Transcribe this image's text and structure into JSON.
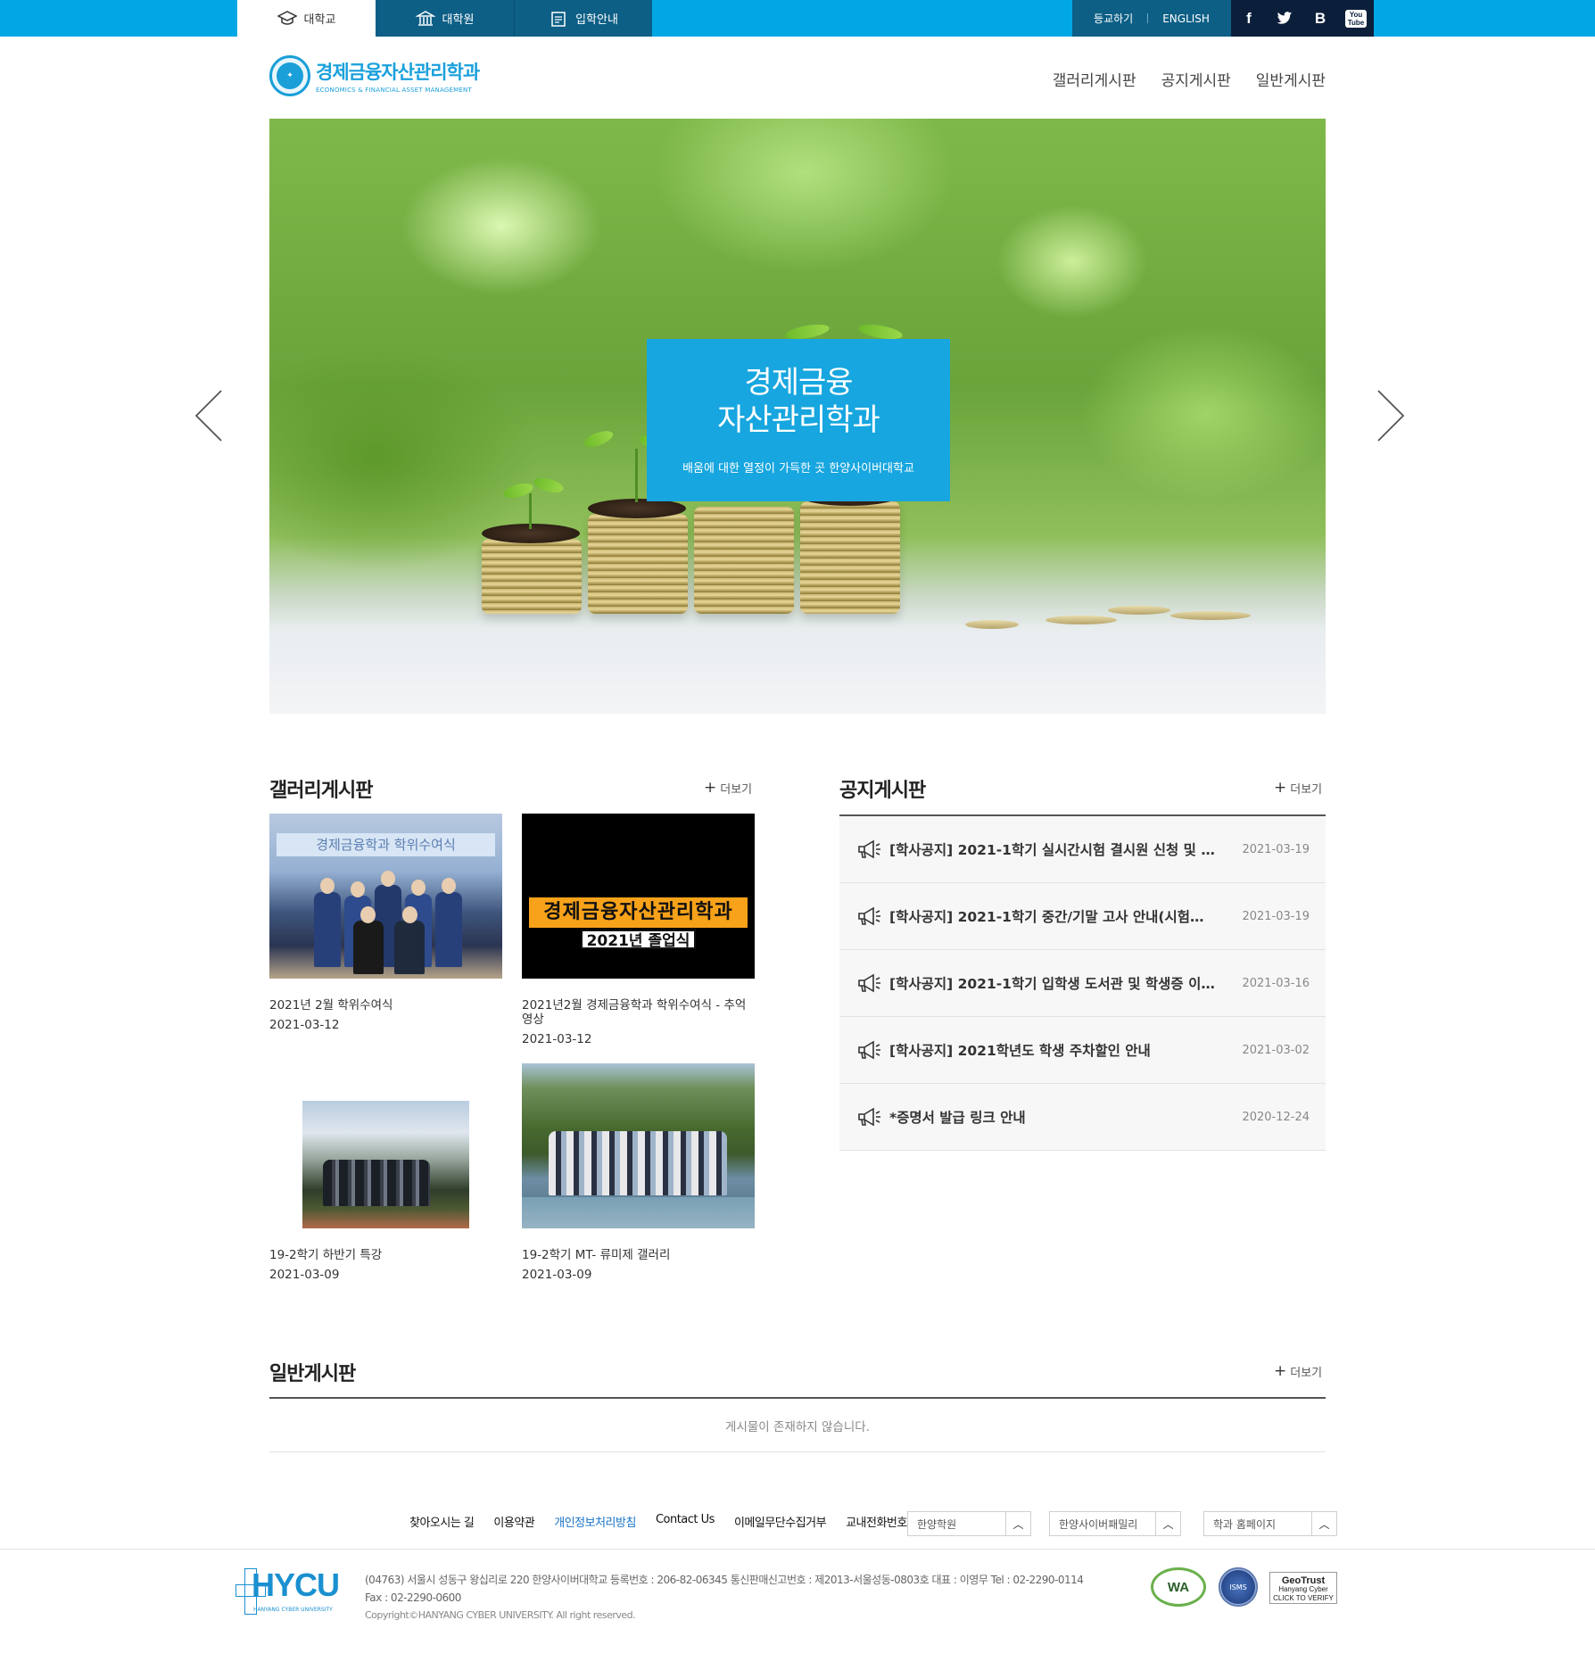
{
  "topbar": {
    "tabs": [
      {
        "label": "대학교",
        "icon": "graduation-cap-icon"
      },
      {
        "label": "대학원",
        "icon": "building-icon"
      },
      {
        "label": "입학안내",
        "icon": "document-icon"
      }
    ],
    "util": {
      "login": "등교하기",
      "english": "ENGLISH"
    },
    "sns": {
      "facebook": "f",
      "twitter": "twitter-bird-icon",
      "blog": "B",
      "youtube_top": "You",
      "youtube_bottom": "Tube"
    }
  },
  "header": {
    "logo": {
      "title": "경제금융자산관리학과",
      "subtitle": "ECONOMICS & FINANCIAL ASSET MANAGEMENT"
    },
    "nav": [
      "갤러리게시판",
      "공지게시판",
      "일반게시판"
    ]
  },
  "hero": {
    "title_line1": "경제금융",
    "title_line2": "자산관리학과",
    "subtitle": "배움에 대한 열정이 가득한 곳 한양사이버대학교"
  },
  "gallery": {
    "title": "갤러리게시판",
    "more": "더보기",
    "items": [
      {
        "title": "2021년 2월 학위수여식",
        "date": "2021-03-12",
        "banner": "경제금융학과 학위수여식"
      },
      {
        "title": "2021년2월 경제금융학과 학위수여식 - 추억영상",
        "date": "2021-03-12",
        "banner": "경제금융자산관리학과",
        "banner2": "2021년 졸업식"
      },
      {
        "title": "19-2학기 하반기 특강",
        "date": "2021-03-09"
      },
      {
        "title": "19-2학기 MT- 류미제 갤러리",
        "date": "2021-03-09"
      }
    ]
  },
  "notice": {
    "title": "공지게시판",
    "more": "더보기",
    "items": [
      {
        "title": "[학사공지] 2021-1학기 실시간시험 결시원 신청 및 …",
        "date": "2021-03-19"
      },
      {
        "title": "[학사공지] 2021-1학기 중간/기말 고사 안내(시험…",
        "date": "2021-03-19"
      },
      {
        "title": "[학사공지] 2021-1학기 입학생 도서관 및 학생증 이…",
        "date": "2021-03-16"
      },
      {
        "title": "[학사공지] 2021학년도 학생 주차할인 안내",
        "date": "2021-03-02"
      },
      {
        "title": "*증명서 발급 링크 안내",
        "date": "2020-12-24"
      }
    ]
  },
  "general": {
    "title": "일반게시판",
    "more": "더보기",
    "empty": "게시물이 존재하지 않습니다."
  },
  "footer": {
    "links": [
      "찾아오시는 길",
      "이용약관",
      "개인정보처리방침",
      "Contact Us",
      "이메일무단수집거부",
      "교내전화번호"
    ],
    "selects": [
      "한양학원",
      "한양사이버패밀리",
      "학과 홈페이지"
    ],
    "logo": {
      "name": "HYCU",
      "sub": "HANYANG CYBER UNIVERSITY"
    },
    "address_line1": "(04763) 서울시 성동구 왕십리로 220 한양사이버대학교   등록번호 : 206-82-06345   통신판매신고번호 : 제2013-서울성동-0803호 대표 : 이영무   Tel : 02-2290-0114",
    "address_line2": "Fax : 02-2290-0600",
    "copyright": "Copyright©HANYANG CYBER UNIVERSITY. All right reserved.",
    "certs": {
      "wa": "WA",
      "kbs": "ISMS",
      "geotrust_top": "GeoTrust",
      "geotrust_sub": "Hanyang Cyber",
      "geotrust_click": "CLICK TO VERIFY"
    }
  },
  "colors": {
    "accent": "#00a7e4",
    "dark_blue": "#0d5f86",
    "hero_box": "#17a6df"
  }
}
